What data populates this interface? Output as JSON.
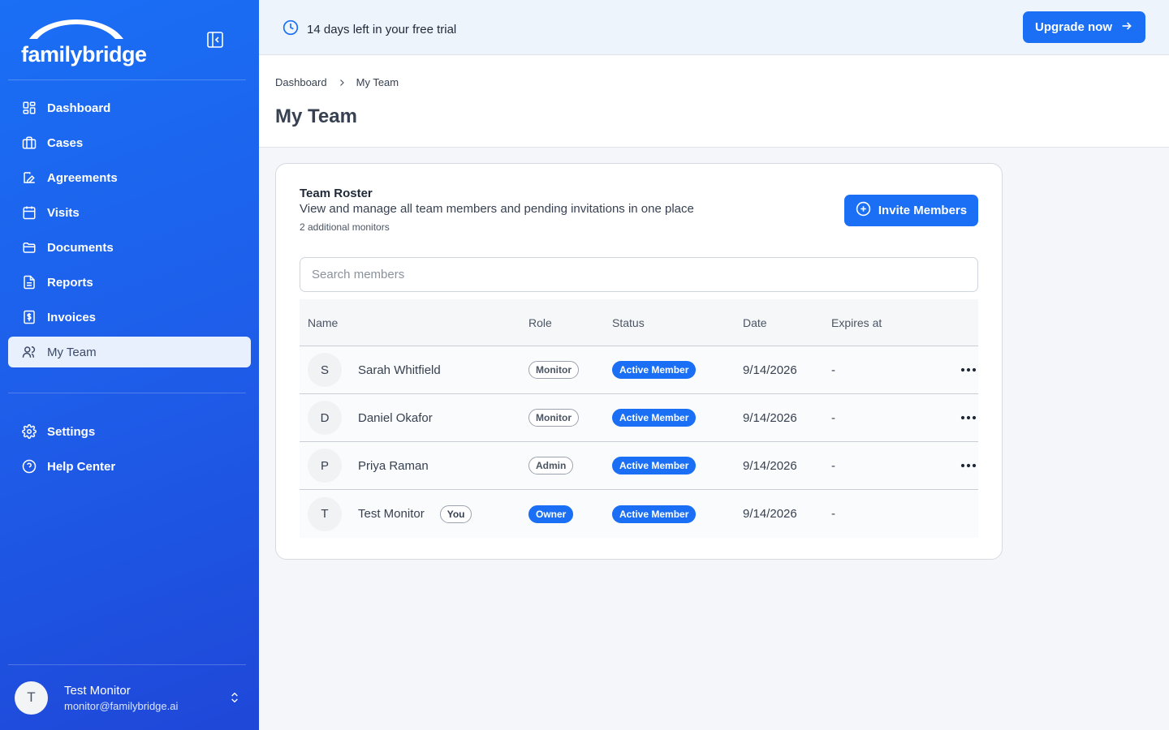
{
  "brand": {
    "logo_text": "familybridge"
  },
  "sidebar": {
    "items": [
      {
        "label": "Dashboard",
        "icon": "grid-icon"
      },
      {
        "label": "Cases",
        "icon": "briefcase-icon"
      },
      {
        "label": "Agreements",
        "icon": "edit-icon"
      },
      {
        "label": "Visits",
        "icon": "calendar-icon"
      },
      {
        "label": "Documents",
        "icon": "folder-icon"
      },
      {
        "label": "Reports",
        "icon": "file-text-icon"
      },
      {
        "label": "Invoices",
        "icon": "dollar-icon"
      },
      {
        "label": "My Team",
        "icon": "users-icon",
        "active": true
      }
    ],
    "secondary": [
      {
        "label": "Settings",
        "icon": "gear-icon"
      },
      {
        "label": "Help Center",
        "icon": "help-icon"
      }
    ],
    "user": {
      "initial": "T",
      "name": "Test Monitor",
      "email": "monitor@familybridge.ai"
    }
  },
  "banner": {
    "message": "14 days left in your free trial",
    "cta": "Upgrade now"
  },
  "breadcrumb": {
    "root": "Dashboard",
    "current": "My Team"
  },
  "page": {
    "title": "My Team"
  },
  "card": {
    "title": "Team Roster",
    "subtitle": "View and manage all team members and pending invitations in one place",
    "note": "2 additional monitors",
    "invite_label": "Invite Members",
    "search_placeholder": "Search members"
  },
  "table": {
    "columns": {
      "name": "Name",
      "role": "Role",
      "status": "Status",
      "date": "Date",
      "expires": "Expires at"
    },
    "rows": [
      {
        "initial": "S",
        "name": "Sarah Whitfield",
        "role": "Monitor",
        "status": "Active Member",
        "date": "9/14/2026",
        "expires": "-"
      },
      {
        "initial": "D",
        "name": "Daniel Okafor",
        "role": "Monitor",
        "status": "Active Member",
        "date": "9/14/2026",
        "expires": "-"
      },
      {
        "initial": "P",
        "name": "Priya Raman",
        "role": "Admin",
        "status": "Active Member",
        "date": "9/14/2026",
        "expires": "-"
      },
      {
        "initial": "T",
        "name": "Test Monitor",
        "you_label": "You",
        "role": "Owner",
        "status": "Active Member",
        "date": "9/14/2026",
        "expires": "-"
      }
    ]
  },
  "colors": {
    "primary": "#1a6ff5",
    "sidebar_active_bg": "#e8f0fe",
    "banner_bg": "#eef4fb"
  }
}
